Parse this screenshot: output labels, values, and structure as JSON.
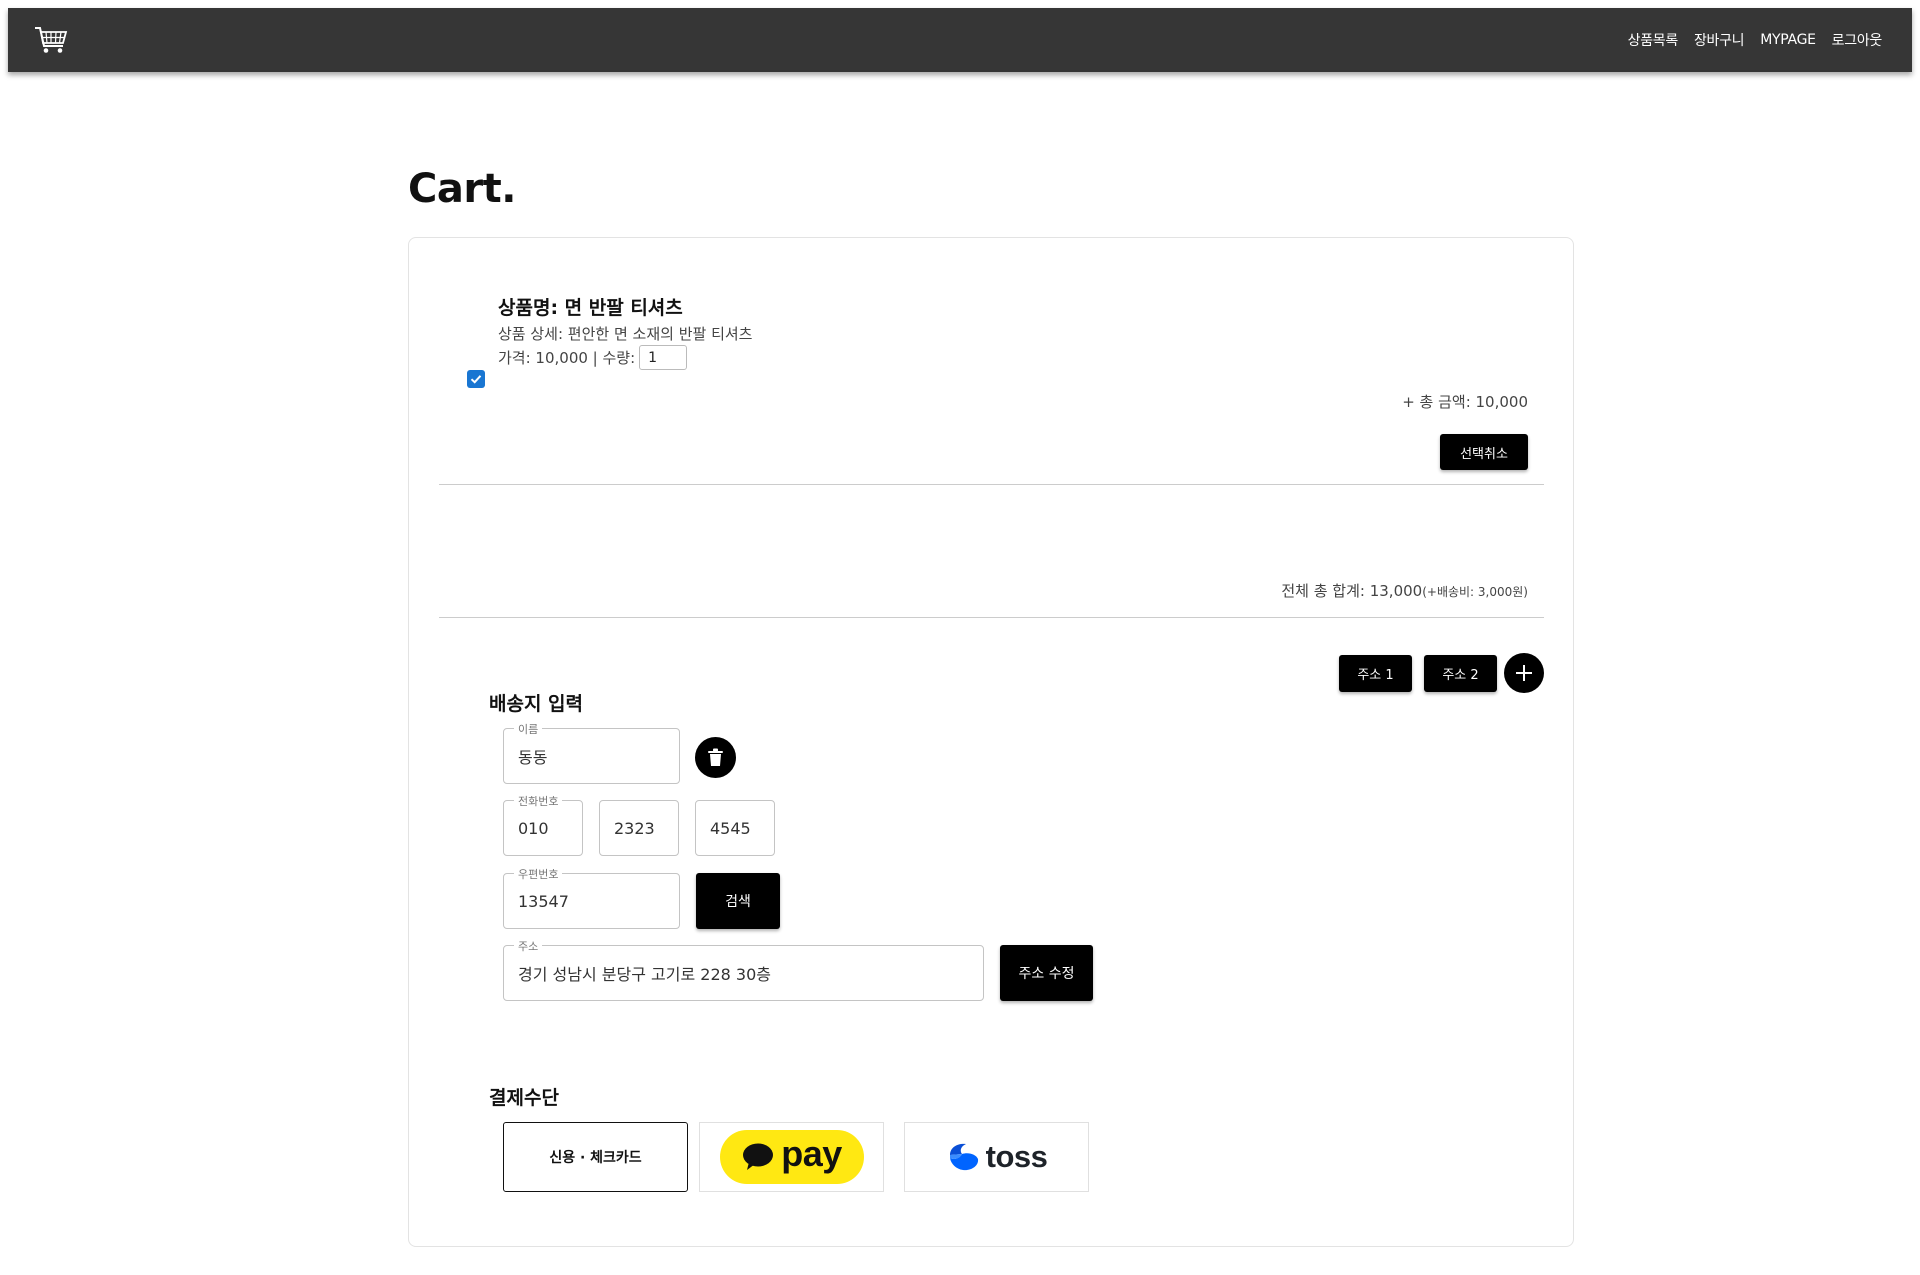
{
  "nav": {
    "items": [
      "상품목록",
      "장바구니",
      "MYPAGE",
      "로그아웃"
    ]
  },
  "page": {
    "title": "Cart."
  },
  "cart": {
    "item": {
      "name": "상품명: 면 반팔 티셔츠",
      "description": "상품 상세: 편안한 면 소재의 반팔 티셔츠",
      "price_label": "가격: 10,000 | 수량:",
      "quantity": "1",
      "checked": true,
      "total": "+ 총 금액: 10,000"
    },
    "deselect_label": "선택취소",
    "grand_total": "전체 총 합계: 13,000",
    "shipping_note": "(+배송비: 3,000원)"
  },
  "address": {
    "buttons": [
      "주소 1",
      "주소 2"
    ],
    "section_title": "배송지 입력",
    "name_label": "이름",
    "name_value": "동동",
    "phone_label": "전화번호",
    "phone": [
      "010",
      "2323",
      "4545"
    ],
    "zip_label": "우편번호",
    "zip_value": "13547",
    "search_label": "검색",
    "addr_label": "주소",
    "addr_value": "경기 성남시 분당구 고기로 228 30층",
    "edit_label": "주소 수정"
  },
  "payment": {
    "section_title": "결제수단",
    "card_label": "신용 · 체크카드",
    "kakao_label": "pay",
    "toss_label": "toss",
    "selected": "card",
    "colors": {
      "kakao_yellow": "#ffe812",
      "toss_blue": "#0064ff"
    }
  },
  "colors": {
    "topbar": "#363636",
    "checkbox": "#1976d2"
  }
}
